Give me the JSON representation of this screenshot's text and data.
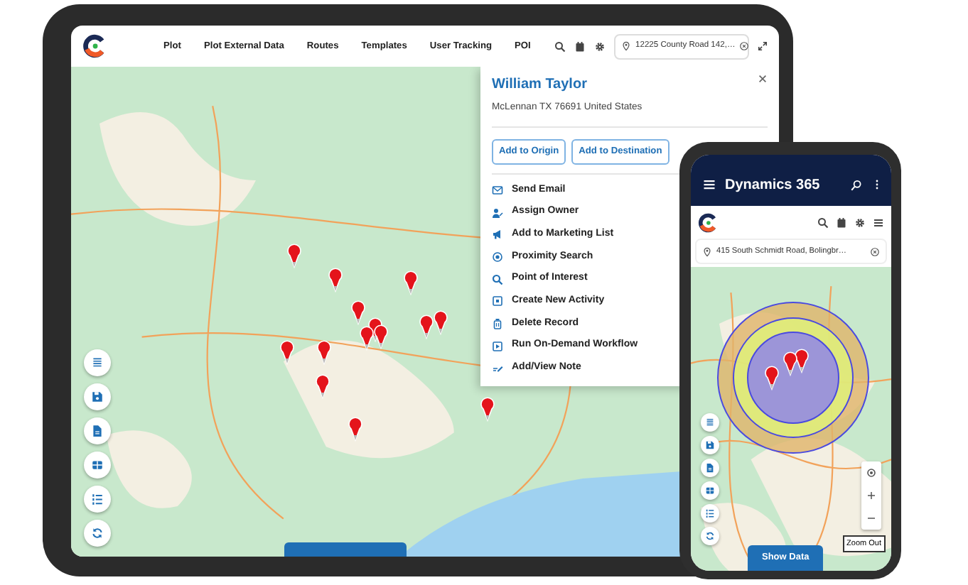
{
  "tablet": {
    "nav": [
      {
        "label": "Plot"
      },
      {
        "label": "Plot External Data"
      },
      {
        "label": "Routes"
      },
      {
        "label": "Templates"
      },
      {
        "label": "User Tracking"
      },
      {
        "label": "POI"
      }
    ],
    "address_field": {
      "value": "12225 County Road 142,…"
    },
    "popup": {
      "name": "William Taylor",
      "address": "McLennan TX 76691 United States",
      "buttons": [
        "Add to Origin",
        "Add to Destination"
      ],
      "actions": [
        {
          "label": "Send Email"
        },
        {
          "label": "Assign Owner"
        },
        {
          "label": "Add to Marketing List"
        },
        {
          "label": "Proximity Search"
        },
        {
          "label": "Point of Interest"
        },
        {
          "label": "Create New Activity"
        },
        {
          "label": "Delete Record"
        },
        {
          "label": "Run On-Demand Workflow"
        },
        {
          "label": "Add/View Note"
        }
      ]
    }
  },
  "phone": {
    "title": "Dynamics 365",
    "address_field": {
      "value": "415 South Schmidt Road, Bolingbr…"
    },
    "zoom_out": "Zoom Out",
    "show_data": "Show Data"
  }
}
